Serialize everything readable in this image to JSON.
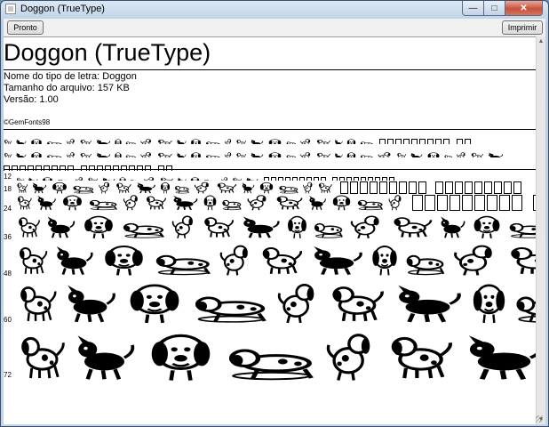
{
  "window": {
    "title": "Doggon (TrueType)"
  },
  "caption": {
    "minimize": "—",
    "maximize": "□",
    "close": "✕"
  },
  "toolbar": {
    "done_label": "Pronto",
    "print_label": "Imprimir"
  },
  "font": {
    "display_name": "Doggon (TrueType)",
    "name_line": "Nome do tipo de letra: Doggon",
    "size_line": "Tamanho do arquivo: 157 KB",
    "version_line": "Versão: 1.00",
    "copyright": "©GemFonts98"
  },
  "sample_sizes": [
    "12",
    "18",
    "24",
    "36",
    "48",
    "60",
    "72"
  ],
  "icons": {
    "app": "app-icon",
    "scroll_up": "scroll-up-arrow-icon",
    "scroll_down": "scroll-down-arrow-icon",
    "dog_glyph": "dog-glyph-icon",
    "missing_glyph": "missing-glyph-box-icon"
  }
}
